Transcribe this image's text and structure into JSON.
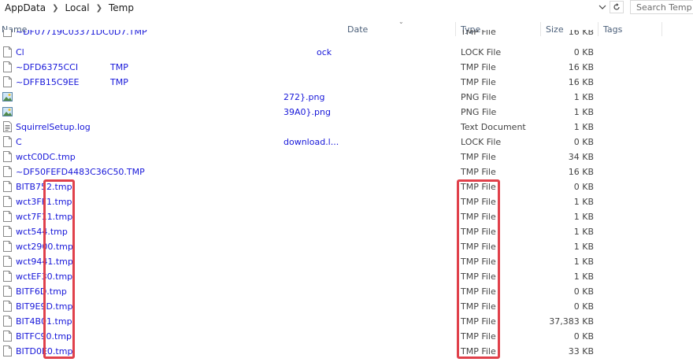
{
  "address_bar": {
    "crumbs": [
      "AppData",
      "Local",
      "Temp"
    ],
    "dropdown_icon": "chevron-down-icon",
    "refresh_icon": "refresh-icon",
    "search_placeholder": "Search Temp"
  },
  "columns": {
    "name": "Name",
    "date": "Date",
    "type": "Type",
    "size": "Size",
    "tags": "Tags"
  },
  "files": [
    {
      "name": "~DF07719C03371DC0D7.TMP",
      "type": "TMP File",
      "size": "16 KB",
      "icon": "file-icon"
    },
    {
      "name": "Cl",
      "name_tail": "ock",
      "type": "LOCK File",
      "size": "0 KB",
      "icon": "file-icon"
    },
    {
      "name": "~DFD6375CCI",
      "name_mid": "TMP",
      "type": "TMP File",
      "size": "16 KB",
      "icon": "file-icon"
    },
    {
      "name": "~DFFB15C9EE",
      "name_mid": "TMP",
      "type": "TMP File",
      "size": "16 KB",
      "icon": "file-icon"
    },
    {
      "name": "",
      "name_tail": "272}.png",
      "type": "PNG File",
      "size": "1 KB",
      "icon": "image-file-icon"
    },
    {
      "name": "",
      "name_tail": "39A0}.png",
      "type": "PNG File",
      "size": "1 KB",
      "icon": "image-file-icon"
    },
    {
      "name": "SquirrelSetup.log",
      "type": "Text Document",
      "size": "1 KB",
      "icon": "text-file-icon"
    },
    {
      "name": "C",
      "name_tail": "download.l...",
      "type": "LOCK File",
      "size": "0 KB",
      "icon": "file-icon"
    },
    {
      "name": "wctC0DC.tmp",
      "type": "TMP File",
      "size": "34 KB",
      "icon": "file-icon"
    },
    {
      "name": "~DF50FEFD4483C36C50.TMP",
      "type": "TMP File",
      "size": "16 KB",
      "icon": "file-icon"
    },
    {
      "name": "BITB752.tmp",
      "type": "TMP File",
      "size": "0 KB",
      "icon": "file-icon"
    },
    {
      "name": "wct3FF1.tmp",
      "type": "TMP File",
      "size": "1 KB",
      "icon": "file-icon"
    },
    {
      "name": "wct7F11.tmp",
      "type": "TMP File",
      "size": "1 KB",
      "icon": "file-icon"
    },
    {
      "name": "wct544.tmp",
      "type": "TMP File",
      "size": "1 KB",
      "icon": "file-icon"
    },
    {
      "name": "wct2900.tmp",
      "type": "TMP File",
      "size": "1 KB",
      "icon": "file-icon"
    },
    {
      "name": "wct9441.tmp",
      "type": "TMP File",
      "size": "1 KB",
      "icon": "file-icon"
    },
    {
      "name": "wctEF30.tmp",
      "type": "TMP File",
      "size": "1 KB",
      "icon": "file-icon"
    },
    {
      "name": "BITF6D.tmp",
      "type": "TMP File",
      "size": "0 KB",
      "icon": "file-icon"
    },
    {
      "name": "BIT9E9D.tmp",
      "type": "TMP File",
      "size": "0 KB",
      "icon": "file-icon"
    },
    {
      "name": "BIT4B01.tmp",
      "type": "TMP File",
      "size": "37,383 KB",
      "icon": "file-icon"
    },
    {
      "name": "BITFC90.tmp",
      "type": "TMP File",
      "size": "0 KB",
      "icon": "file-icon"
    },
    {
      "name": "BITD0E0.tmp",
      "type": "TMP File",
      "size": "33 KB",
      "icon": "file-icon"
    }
  ],
  "colors": {
    "link_blue": "#1717d9",
    "highlight_red": "#e0414b",
    "header_text": "#4c607a"
  }
}
